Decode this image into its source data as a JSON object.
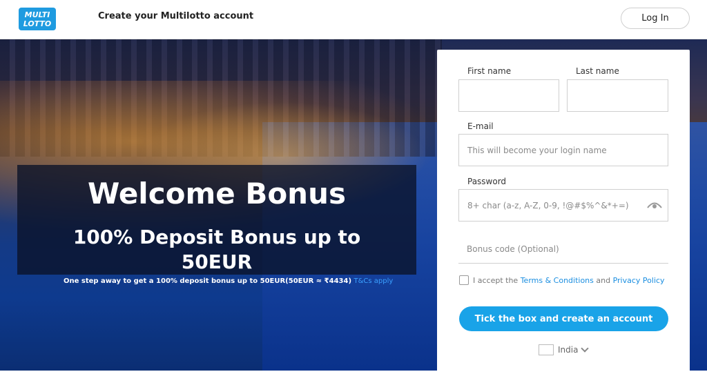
{
  "header": {
    "title": "Create your Multilotto account",
    "login_label": "Log In",
    "logo_text": [
      "MULTI",
      "LOTTO"
    ]
  },
  "promo": {
    "title": "Welcome Bonus",
    "subtitle": "100% Deposit Bonus up to 50EUR",
    "note": "One step away to get a 100% deposit bonus up to 50EUR(50EUR ≈ ₹4434)",
    "tc_link": "T&Cs apply"
  },
  "form": {
    "first_name_label": "First name",
    "last_name_label": "Last name",
    "email_label": "E-mail",
    "email_placeholder": "This will become your login name",
    "password_label": "Password",
    "password_placeholder": "8+ char (a-z, A-Z, 0-9, !@#$%^&*+=)",
    "bonus_placeholder": "Bonus code (Optional)",
    "terms_prefix": "I accept the",
    "terms_link": "Terms & Conditions",
    "terms_and": "and",
    "privacy_link": "Privacy Policy",
    "cta_label": "Tick the box and create an account",
    "country": "India"
  },
  "colors": {
    "accent": "#19a3e8",
    "link": "#1a8ee0",
    "logo_blue": "#1f9be0"
  }
}
